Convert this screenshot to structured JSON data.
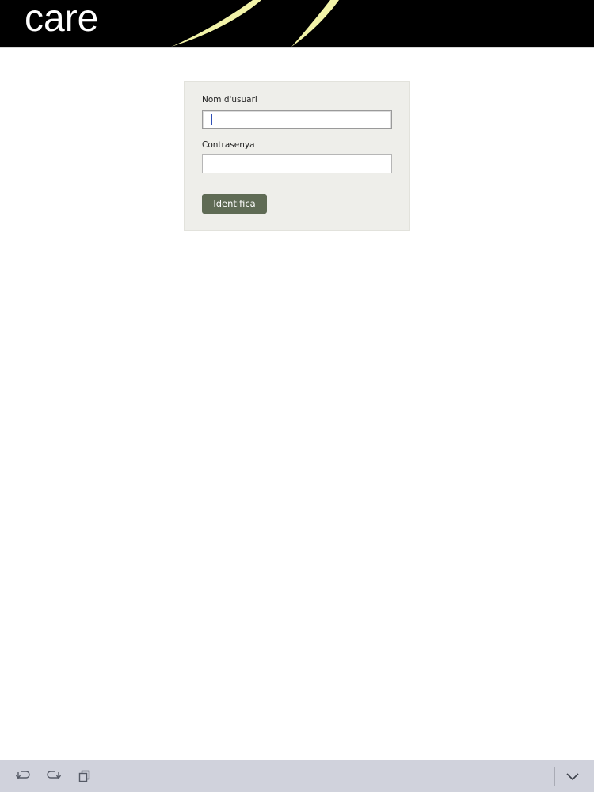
{
  "header": {
    "logo_text": "care"
  },
  "login_form": {
    "username_label": "Nom d'usuari",
    "username_value": "",
    "password_label": "Contrasenya",
    "password_value": "",
    "submit_label": "Identifica"
  },
  "bottom_bar": {
    "icons": [
      "undo-icon",
      "redo-icon",
      "copy-icon",
      "chevron-down-icon"
    ]
  },
  "colors": {
    "header_bg": "#000000",
    "swoosh": "#f2f3a8",
    "form_bg": "#eeeeea",
    "button_bg": "#5f6b55",
    "bottom_bar_bg": "#d0d2dc"
  }
}
